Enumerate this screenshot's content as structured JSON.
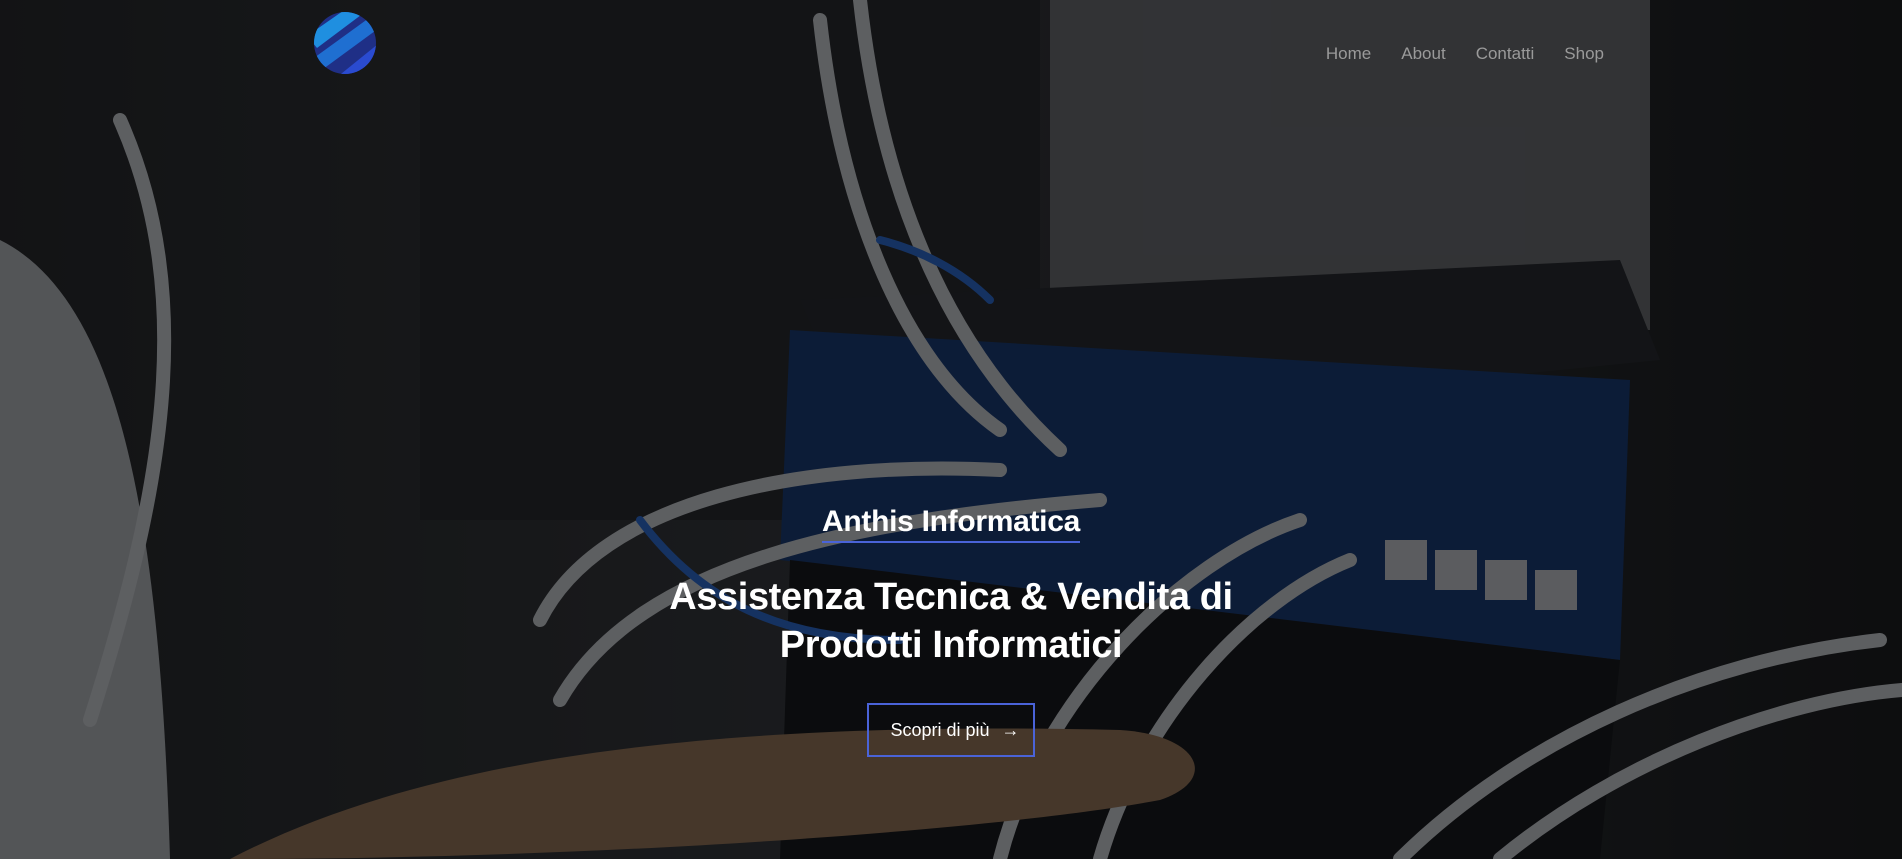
{
  "nav": {
    "items": [
      {
        "label": "Home"
      },
      {
        "label": "About"
      },
      {
        "label": "Contatti"
      },
      {
        "label": "Shop"
      }
    ]
  },
  "hero": {
    "brand": "Anthis Informatica",
    "headline_line1": "Assistenza Tecnica & Vendita di",
    "headline_line2": "Prodotti Informatici",
    "cta_label": "Scopri di più",
    "cta_icon": "arrow-right-icon"
  },
  "colors": {
    "accent": "#4a63d8",
    "nav_text": "#9a9a9a",
    "logo_blue": "#1f6fd1"
  }
}
